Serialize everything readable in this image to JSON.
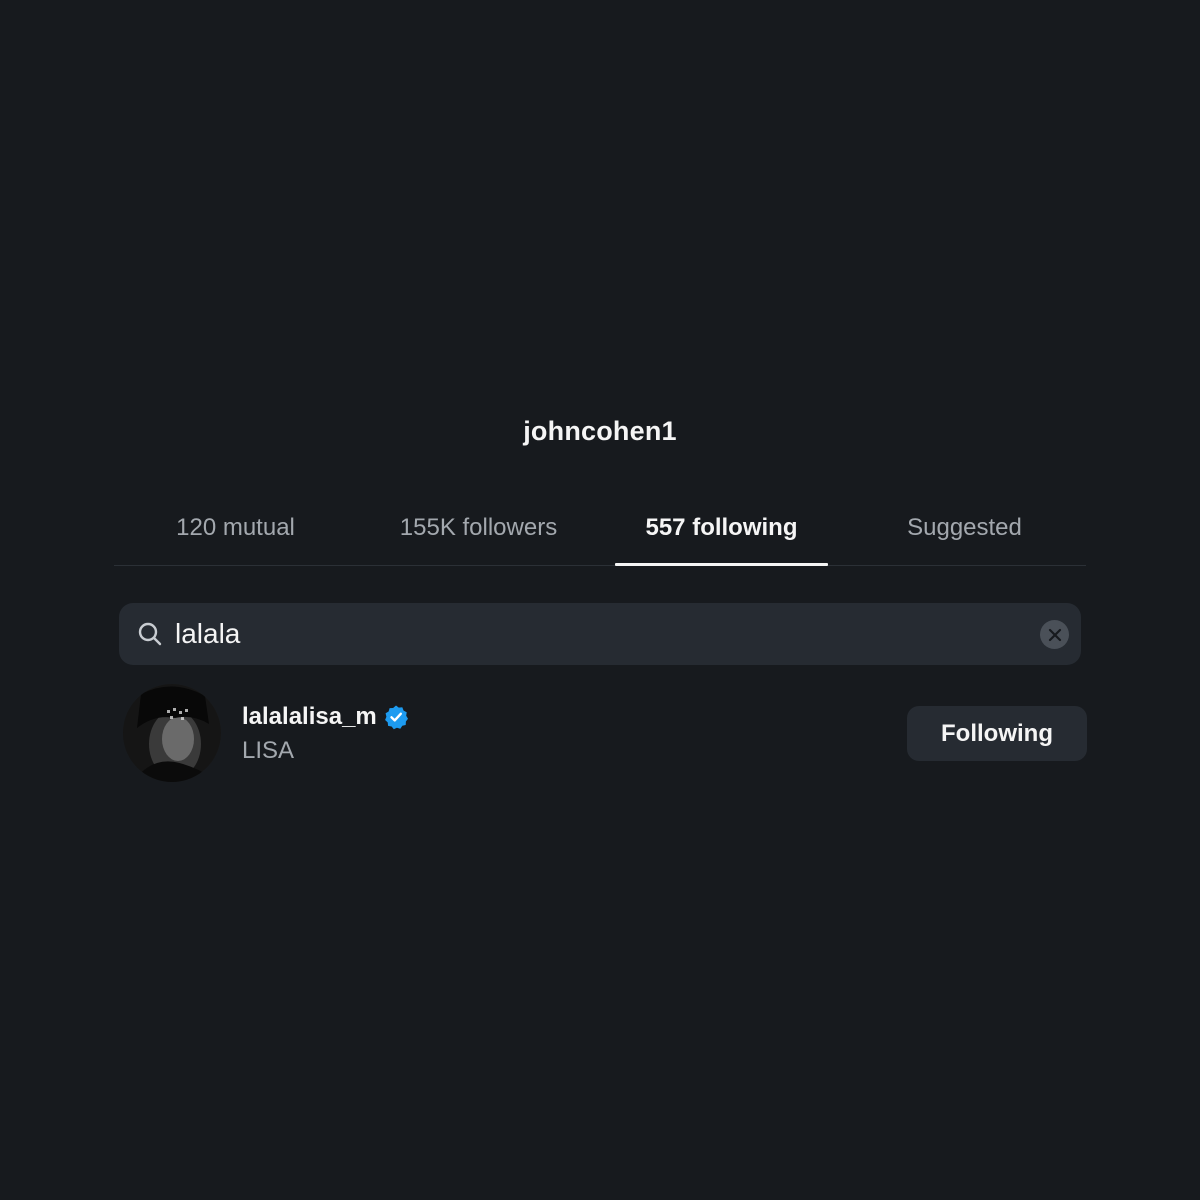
{
  "header": {
    "title": "johncohen1"
  },
  "tabs": [
    {
      "label": "120 mutual",
      "active": false
    },
    {
      "label": "155K followers",
      "active": false
    },
    {
      "label": "557 following",
      "active": true
    },
    {
      "label": "Suggested",
      "active": false
    }
  ],
  "search": {
    "value": "lalala",
    "icon": "search-icon",
    "clear_icon": "close-icon"
  },
  "results": [
    {
      "username": "lalalalisa_m",
      "full_name": "LISA",
      "verified": true,
      "button_label": "Following"
    }
  ],
  "colors": {
    "background": "#171a1e",
    "surface": "#262b32",
    "verified": "#1d9bf0",
    "secondary_text": "#a3a8ae"
  }
}
